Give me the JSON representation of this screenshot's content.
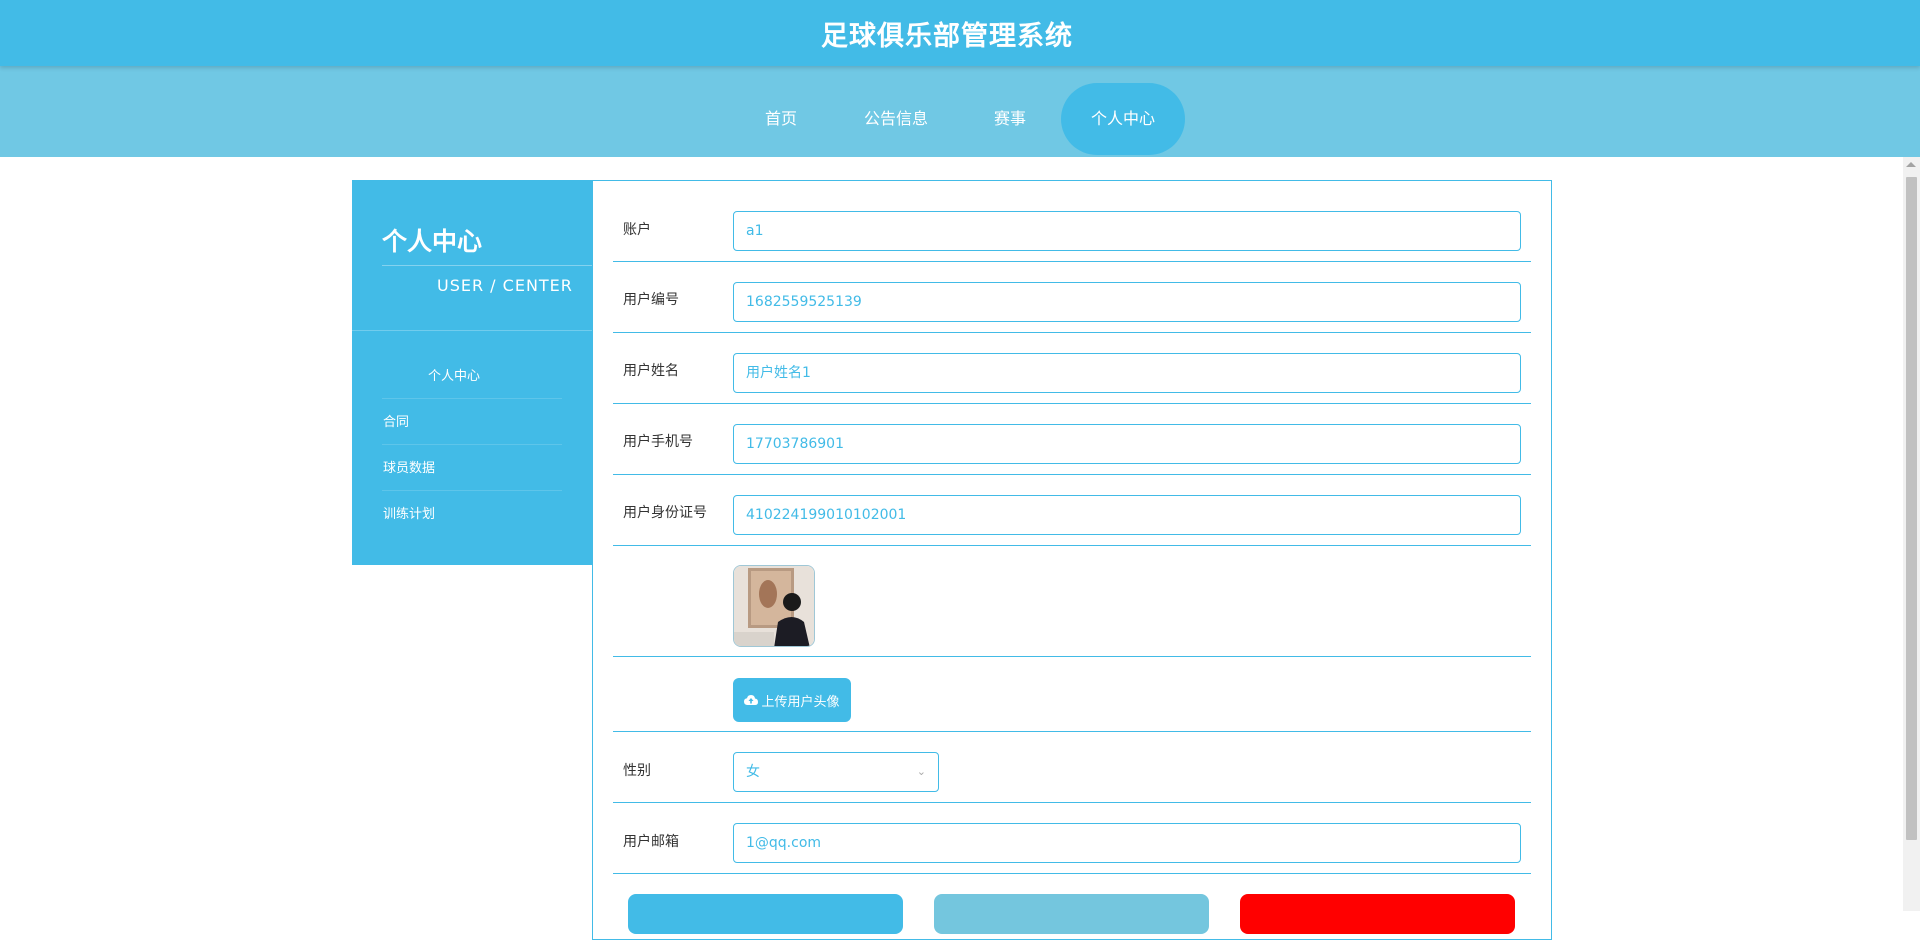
{
  "app": {
    "title": "足球俱乐部管理系统"
  },
  "nav": {
    "items": [
      {
        "label": "首页"
      },
      {
        "label": "公告信息"
      },
      {
        "label": "赛事"
      },
      {
        "label": "个人中心"
      }
    ],
    "active": "个人中心"
  },
  "sidebar": {
    "title": "个人中心",
    "subtitle": "USER / CENTER",
    "items": [
      {
        "label": "个人中心"
      },
      {
        "label": "合同"
      },
      {
        "label": "球员数据"
      },
      {
        "label": "训练计划"
      }
    ]
  },
  "form": {
    "fields": [
      {
        "label": "账户",
        "value": "a1"
      },
      {
        "label": "用户编号",
        "value": "1682559525139"
      },
      {
        "label": "用户姓名",
        "value": "用户姓名1"
      },
      {
        "label": "用户手机号",
        "value": "17703786901"
      },
      {
        "label": "用户身份证号",
        "value": "410224199010102001"
      }
    ],
    "upload_label": "上传用户头像",
    "gender": {
      "label": "性别",
      "value": "女"
    },
    "email": {
      "label": "用户邮箱",
      "value": "1@qq.com"
    }
  },
  "colors": {
    "primary": "#42bbe7",
    "nav_bg": "#70c8e4",
    "button_light": "#74c6de",
    "danger": "#ff0000"
  },
  "icons": {
    "upload": "cloud-upload-icon",
    "dropdown": "chevron-down-icon"
  }
}
